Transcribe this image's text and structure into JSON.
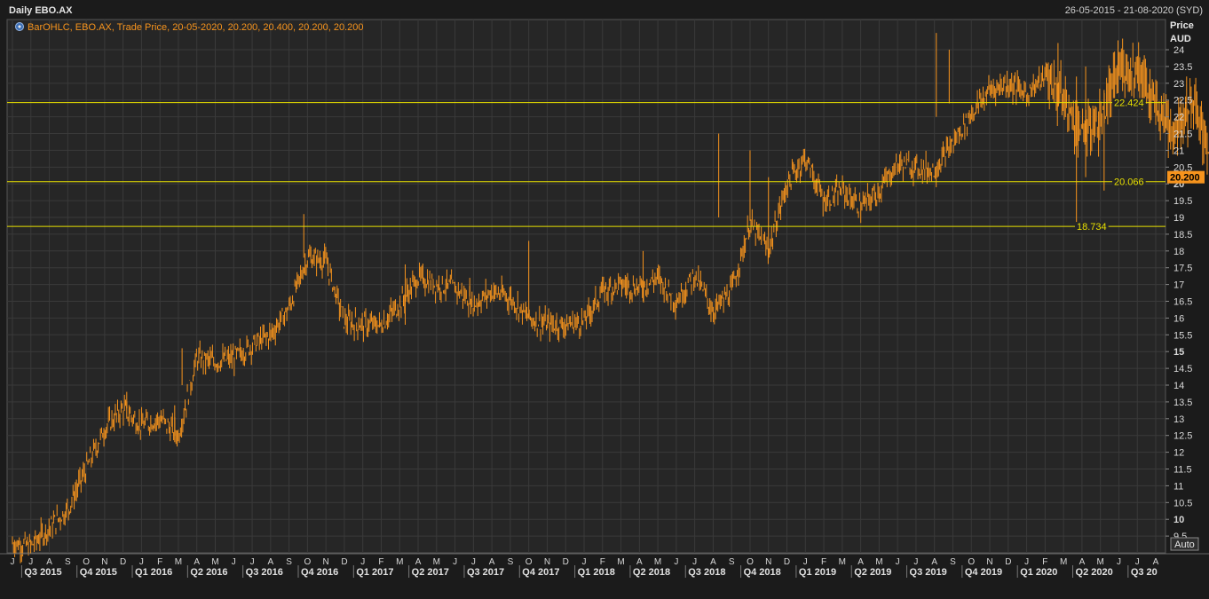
{
  "header": {
    "title": "Daily EBO.AX",
    "date_range": "26-05-2015 - 21-08-2020 (SYD)"
  },
  "legend": {
    "label": "BarOHLC, EBO.AX, Trade Price, 20-05-2020, 20.200, 20.400, 20.200, 20.200"
  },
  "axis": {
    "y_title": "Price",
    "y_unit": "AUD",
    "auto_button": "Auto"
  },
  "colors": {
    "background": "#1b1b1b",
    "plot": "#262626",
    "grid": "#3a3a3a",
    "bars": "#f7941d",
    "hlines": "#e8e000",
    "last_price_bg": "#f7941d"
  },
  "last_price": "20.200",
  "chart_data": {
    "type": "bar",
    "subtype": "ohlc",
    "ylim": [
      9,
      24.9
    ],
    "y_ticks": [
      "9.5",
      "10",
      "10.5",
      "11",
      "11.5",
      "12",
      "12.5",
      "13",
      "13.5",
      "14",
      "14.5",
      "15",
      "15.5",
      "16",
      "16.5",
      "17",
      "17.5",
      "18",
      "18.5",
      "19",
      "19.5",
      "20",
      "20.5",
      "21",
      "21.5",
      "22",
      "22.5",
      "23",
      "23.5",
      "24"
    ],
    "y_major": [
      "10",
      "15",
      "20"
    ],
    "months": [
      "J",
      "J",
      "A",
      "S",
      "O",
      "N",
      "D",
      "J",
      "F",
      "M",
      "A",
      "M",
      "J",
      "J",
      "A",
      "S",
      "O",
      "N",
      "D",
      "J",
      "F",
      "M",
      "A",
      "M",
      "J",
      "J",
      "A",
      "S",
      "O",
      "N",
      "D",
      "J",
      "F",
      "M",
      "A",
      "M",
      "J",
      "J",
      "A",
      "S",
      "O",
      "N",
      "D",
      "J",
      "F",
      "M",
      "A",
      "M",
      "J",
      "J",
      "A",
      "S",
      "O",
      "N",
      "D",
      "J",
      "F",
      "M",
      "A",
      "M",
      "J",
      "J",
      "A"
    ],
    "quarters": [
      "Q3 2015",
      "Q4 2015",
      "Q1 2016",
      "Q2 2016",
      "Q3 2016",
      "Q4 2016",
      "Q1 2017",
      "Q2 2017",
      "Q3 2017",
      "Q4 2017",
      "Q1 2018",
      "Q2 2018",
      "Q3 2018",
      "Q4 2018",
      "Q1 2019",
      "Q2 2019",
      "Q3 2019",
      "Q4 2019",
      "Q1 2020",
      "Q2 2020",
      "Q3 20"
    ],
    "hlines": [
      {
        "value": 22.424,
        "label": "22.424"
      },
      {
        "value": 20.066,
        "label": "20.066"
      },
      {
        "value": 18.734,
        "label": "18.734"
      }
    ],
    "price_path": [
      [
        0,
        9.3
      ],
      [
        1,
        9.2
      ],
      [
        3,
        10.3
      ],
      [
        4,
        11.5
      ],
      [
        5,
        12.7
      ],
      [
        6,
        13.3
      ],
      [
        7,
        12.8
      ],
      [
        8,
        13.0
      ],
      [
        9,
        12.5
      ],
      [
        10,
        14.8
      ],
      [
        11,
        14.7
      ],
      [
        12,
        14.8
      ],
      [
        13,
        15.2
      ],
      [
        14,
        15.5
      ],
      [
        15,
        16.3
      ],
      [
        16,
        17.8
      ],
      [
        17,
        17.7
      ],
      [
        18,
        15.9
      ],
      [
        19,
        15.8
      ],
      [
        20,
        15.8
      ],
      [
        21,
        16.4
      ],
      [
        22,
        17.2
      ],
      [
        23,
        17.0
      ],
      [
        24,
        16.9
      ],
      [
        25,
        16.4
      ],
      [
        26,
        16.8
      ],
      [
        27,
        16.6
      ],
      [
        28,
        16.0
      ],
      [
        29,
        15.8
      ],
      [
        30,
        15.8
      ],
      [
        31,
        15.9
      ],
      [
        32,
        16.8
      ],
      [
        33,
        17.0
      ],
      [
        34,
        16.9
      ],
      [
        35,
        17.2
      ],
      [
        36,
        16.5
      ],
      [
        37,
        17.3
      ],
      [
        38,
        16.2
      ],
      [
        39,
        16.8
      ],
      [
        40,
        18.8
      ],
      [
        41,
        18.0
      ],
      [
        42,
        20.0
      ],
      [
        43,
        20.8
      ],
      [
        44,
        19.5
      ],
      [
        45,
        19.8
      ],
      [
        46,
        19.3
      ],
      [
        47,
        19.8
      ],
      [
        48,
        20.6
      ],
      [
        49,
        20.5
      ],
      [
        50,
        20.4
      ],
      [
        51,
        21.2
      ],
      [
        52,
        22.1
      ],
      [
        53,
        22.8
      ],
      [
        54,
        23.0
      ],
      [
        55,
        22.7
      ],
      [
        56,
        23.2
      ],
      [
        57,
        22.5
      ],
      [
        58,
        21.5
      ],
      [
        59,
        21.8
      ],
      [
        60,
        23.4
      ],
      [
        61,
        23.4
      ],
      [
        62,
        22.3
      ],
      [
        63,
        21.6
      ],
      [
        64,
        22.4
      ],
      [
        65,
        20.9
      ],
      [
        65.4,
        20.2
      ],
      [
        65.6,
        20.2
      ]
    ],
    "spikes": [
      [
        15.8,
        17.8,
        19.1
      ],
      [
        21.3,
        15.8,
        17.6
      ],
      [
        28.0,
        16.0,
        18.3
      ],
      [
        34.2,
        16.5,
        18.0
      ],
      [
        38.3,
        19.0,
        21.5
      ],
      [
        40.0,
        18.9,
        21.0
      ],
      [
        50.1,
        22.0,
        24.5
      ],
      [
        50.8,
        22.4,
        24.0
      ],
      [
        56.7,
        22.3,
        24.2
      ],
      [
        57.7,
        18.7,
        23.2
      ],
      [
        58.2,
        20.2,
        23.5
      ],
      [
        59.2,
        19.8,
        22.8
      ],
      [
        41.0,
        17.8,
        20.2
      ],
      [
        24.8,
        16.4,
        17.2
      ],
      [
        6.2,
        13.0,
        13.8
      ],
      [
        8.8,
        12.3,
        13.4
      ],
      [
        9.2,
        14.0,
        15.1
      ]
    ]
  }
}
